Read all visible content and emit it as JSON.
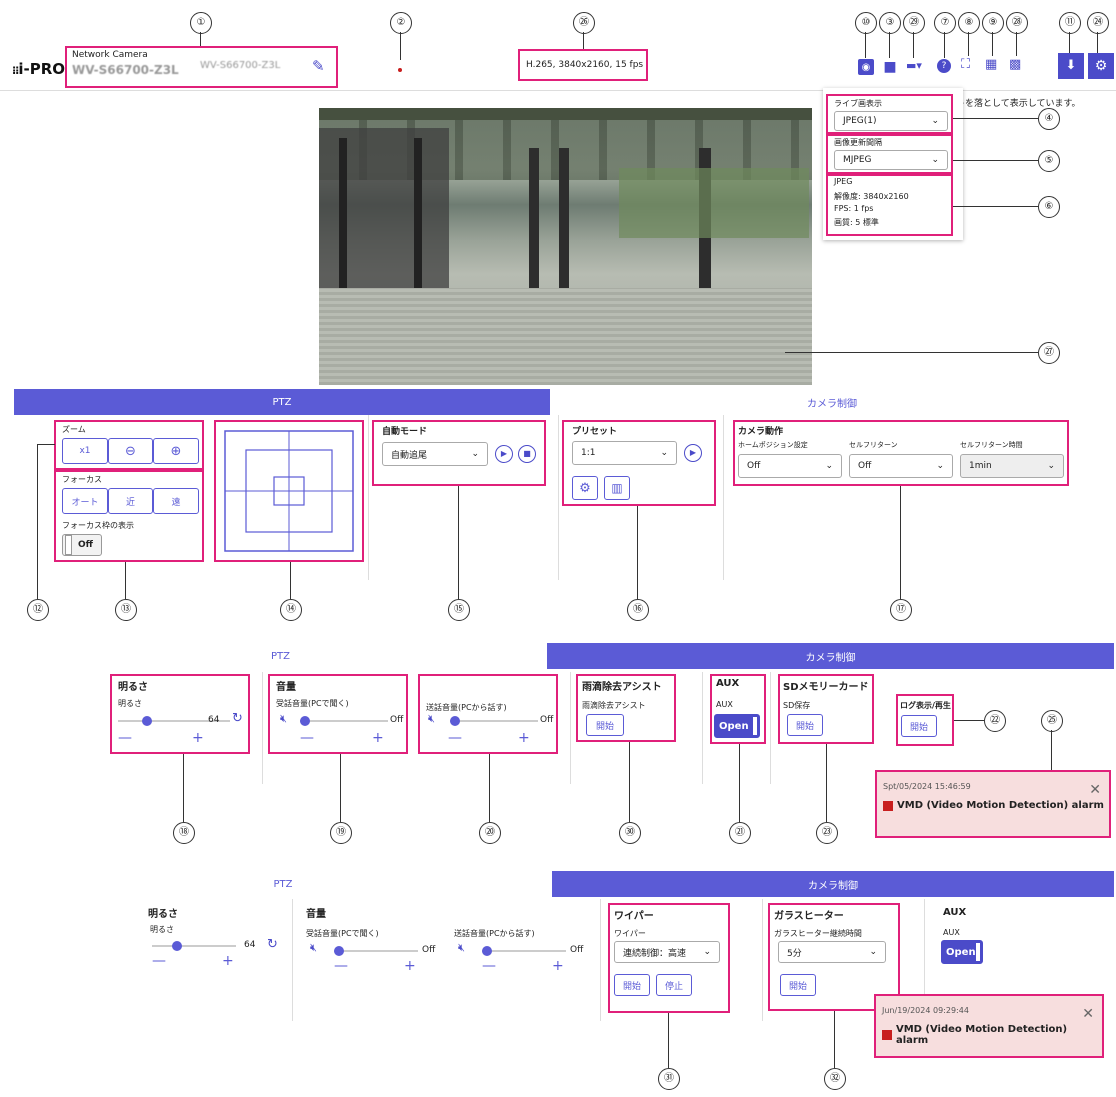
{
  "callouts": {
    "c1": "①",
    "c2": "②",
    "c3": "③",
    "c4": "④",
    "c5": "⑤",
    "c6": "⑥",
    "c7": "⑦",
    "c8": "⑧",
    "c9": "⑨",
    "c10": "⑩",
    "c11": "⑪",
    "c12": "⑫",
    "c13": "⑬",
    "c14": "⑭",
    "c15": "⑮",
    "c16": "⑯",
    "c17": "⑰",
    "c18": "⑱",
    "c19": "⑲",
    "c20": "⑳",
    "c21": "㉑",
    "c22": "㉒",
    "c23": "㉓",
    "c24": "㉔",
    "c25": "㉕",
    "c26": "㉖",
    "c27": "㉗",
    "c28": "㉘",
    "c29": "㉙",
    "c30": "㉚",
    "c31": "㉛",
    "c32": "㉜"
  },
  "header": {
    "brand": "i-PRO",
    "product_type": "Network Camera",
    "model_name": "WV-S66700-Z3L",
    "model_name_alt": "WV-S66700-Z3L",
    "stream_info": "H.265, 3840x2160, 15 fps",
    "notice": "トを落として表示しています。"
  },
  "toolbar": {
    "icons": [
      "camera-icon",
      "video-icon",
      "stream-icon",
      "help-icon",
      "fullscreen-icon",
      "multiscreen-icon",
      "grid-icon",
      "live-icon",
      "settings-icon"
    ]
  },
  "stream_panel": {
    "live_label": "ライブ画表示",
    "live_value": "JPEG(1)",
    "refresh_label": "画像更新間隔",
    "refresh_value": "MJPEG",
    "info_format": "JPEG",
    "info_resolution": "解像度: 3840x2160",
    "info_fps": "FPS: 1 fps",
    "info_quality": "画質: 5 標準"
  },
  "panel1": {
    "tab_ptz": "PTZ",
    "tab_camera": "カメラ制御",
    "zoom_label": "ズーム",
    "zoom_x1": "x1",
    "focus_label": "フォーカス",
    "focus_auto": "オート",
    "focus_near": "近",
    "focus_far": "遠",
    "focus_frame_label": "フォーカス枠の表示",
    "focus_frame_value": "Off",
    "auto_mode_label": "自動モード",
    "auto_mode_value": "自動追尾",
    "preset_label": "プリセット",
    "preset_value": "1:1",
    "camera_action_label": "カメラ動作",
    "home_pos_label": "ホームポジション設定",
    "home_pos_value": "Off",
    "self_return_label": "セルフリターン",
    "self_return_value": "Off",
    "self_return_time_label": "セルフリターン時間",
    "self_return_time_value": "1min"
  },
  "panel2": {
    "tab_ptz": "PTZ",
    "tab_camera": "カメラ制御",
    "brightness_title": "明るさ",
    "brightness_label": "明るさ",
    "brightness_value": "64",
    "volume_title": "音量",
    "recv_label": "受話音量(PCで聞く)",
    "recv_value": "Off",
    "send_label": "送話音量(PCから話す)",
    "send_value": "Off",
    "rain_title": "雨滴除去アシスト",
    "rain_label": "雨滴除去アシスト",
    "rain_btn": "開始",
    "aux_title": "AUX",
    "aux_label": "AUX",
    "aux_value": "Open",
    "sd_title": "SDメモリーカード",
    "sd_label": "SD保存",
    "sd_btn": "開始",
    "log_title": "ログ表示/再生",
    "log_btn": "開始",
    "alarm_time": "Spt/05/2024 15:46:59",
    "alarm_msg": "VMD (Video Motion Detection) alarm"
  },
  "panel3": {
    "tab_ptz": "PTZ",
    "tab_camera": "カメラ制御",
    "brightness_title": "明るさ",
    "brightness_label": "明るさ",
    "brightness_value": "64",
    "volume_title": "音量",
    "recv_label": "受話音量(PCで聞く)",
    "recv_value": "Off",
    "send_label": "送話音量(PCから話す)",
    "send_value": "Off",
    "wiper_title": "ワイパー",
    "wiper_label": "ワイパー",
    "wiper_value": "連続制御：高速",
    "wiper_start": "開始",
    "wiper_stop": "停止",
    "heater_title": "ガラスヒーター",
    "heater_label": "ガラスヒーター継続時間",
    "heater_value": "5分",
    "heater_btn": "開始",
    "aux_title": "AUX",
    "aux_label": "AUX",
    "aux_value": "Open",
    "alarm_time": "Jun/19/2024 09:29:44",
    "alarm_msg": "VMD (Video Motion Detection) alarm"
  },
  "colors": {
    "accent": "#5b5bd6",
    "highlight": "#e0207a",
    "alarm_bg": "#f7dede"
  }
}
